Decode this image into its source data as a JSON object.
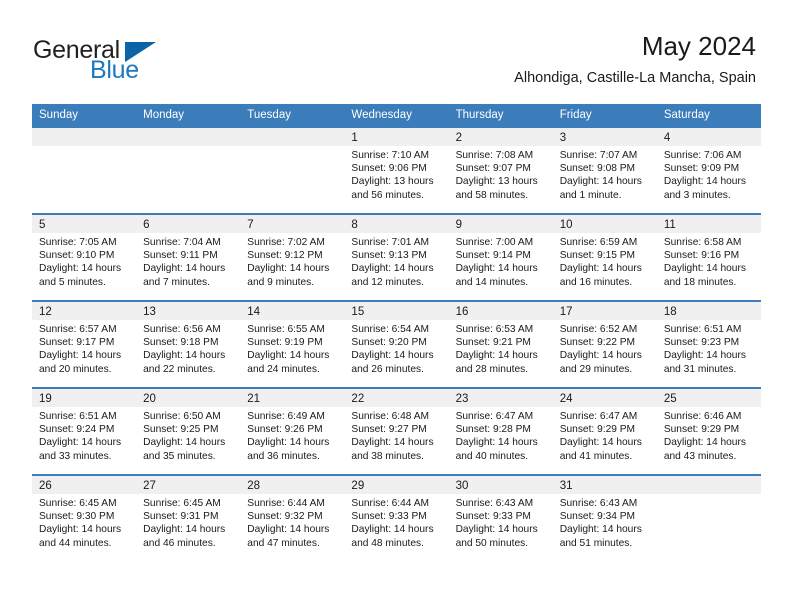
{
  "brand": {
    "name_part1": "General",
    "name_part2": "Blue",
    "accent_color": "#0a64a8",
    "blue_text_color": "#1c79c0"
  },
  "header": {
    "title": "May 2024",
    "subtitle": "Alhondiga, Castille-La Mancha, Spain",
    "weekday_header_bg": "#3b7cba",
    "day_band_bg": "#f0f0f0"
  },
  "weekdays": [
    "Sunday",
    "Monday",
    "Tuesday",
    "Wednesday",
    "Thursday",
    "Friday",
    "Saturday"
  ],
  "labels": {
    "sunrise": "Sunrise:",
    "sunset": "Sunset:",
    "daylight": "Daylight:"
  },
  "weeks": [
    [
      {
        "day": "",
        "sunrise": "",
        "sunset": "",
        "daylight_line1": "",
        "daylight_line2": ""
      },
      {
        "day": "",
        "sunrise": "",
        "sunset": "",
        "daylight_line1": "",
        "daylight_line2": ""
      },
      {
        "day": "",
        "sunrise": "",
        "sunset": "",
        "daylight_line1": "",
        "daylight_line2": ""
      },
      {
        "day": "1",
        "sunrise": "Sunrise: 7:10 AM",
        "sunset": "Sunset: 9:06 PM",
        "daylight_line1": "Daylight: 13 hours",
        "daylight_line2": "and 56 minutes."
      },
      {
        "day": "2",
        "sunrise": "Sunrise: 7:08 AM",
        "sunset": "Sunset: 9:07 PM",
        "daylight_line1": "Daylight: 13 hours",
        "daylight_line2": "and 58 minutes."
      },
      {
        "day": "3",
        "sunrise": "Sunrise: 7:07 AM",
        "sunset": "Sunset: 9:08 PM",
        "daylight_line1": "Daylight: 14 hours",
        "daylight_line2": "and 1 minute."
      },
      {
        "day": "4",
        "sunrise": "Sunrise: 7:06 AM",
        "sunset": "Sunset: 9:09 PM",
        "daylight_line1": "Daylight: 14 hours",
        "daylight_line2": "and 3 minutes."
      }
    ],
    [
      {
        "day": "5",
        "sunrise": "Sunrise: 7:05 AM",
        "sunset": "Sunset: 9:10 PM",
        "daylight_line1": "Daylight: 14 hours",
        "daylight_line2": "and 5 minutes."
      },
      {
        "day": "6",
        "sunrise": "Sunrise: 7:04 AM",
        "sunset": "Sunset: 9:11 PM",
        "daylight_line1": "Daylight: 14 hours",
        "daylight_line2": "and 7 minutes."
      },
      {
        "day": "7",
        "sunrise": "Sunrise: 7:02 AM",
        "sunset": "Sunset: 9:12 PM",
        "daylight_line1": "Daylight: 14 hours",
        "daylight_line2": "and 9 minutes."
      },
      {
        "day": "8",
        "sunrise": "Sunrise: 7:01 AM",
        "sunset": "Sunset: 9:13 PM",
        "daylight_line1": "Daylight: 14 hours",
        "daylight_line2": "and 12 minutes."
      },
      {
        "day": "9",
        "sunrise": "Sunrise: 7:00 AM",
        "sunset": "Sunset: 9:14 PM",
        "daylight_line1": "Daylight: 14 hours",
        "daylight_line2": "and 14 minutes."
      },
      {
        "day": "10",
        "sunrise": "Sunrise: 6:59 AM",
        "sunset": "Sunset: 9:15 PM",
        "daylight_line1": "Daylight: 14 hours",
        "daylight_line2": "and 16 minutes."
      },
      {
        "day": "11",
        "sunrise": "Sunrise: 6:58 AM",
        "sunset": "Sunset: 9:16 PM",
        "daylight_line1": "Daylight: 14 hours",
        "daylight_line2": "and 18 minutes."
      }
    ],
    [
      {
        "day": "12",
        "sunrise": "Sunrise: 6:57 AM",
        "sunset": "Sunset: 9:17 PM",
        "daylight_line1": "Daylight: 14 hours",
        "daylight_line2": "and 20 minutes."
      },
      {
        "day": "13",
        "sunrise": "Sunrise: 6:56 AM",
        "sunset": "Sunset: 9:18 PM",
        "daylight_line1": "Daylight: 14 hours",
        "daylight_line2": "and 22 minutes."
      },
      {
        "day": "14",
        "sunrise": "Sunrise: 6:55 AM",
        "sunset": "Sunset: 9:19 PM",
        "daylight_line1": "Daylight: 14 hours",
        "daylight_line2": "and 24 minutes."
      },
      {
        "day": "15",
        "sunrise": "Sunrise: 6:54 AM",
        "sunset": "Sunset: 9:20 PM",
        "daylight_line1": "Daylight: 14 hours",
        "daylight_line2": "and 26 minutes."
      },
      {
        "day": "16",
        "sunrise": "Sunrise: 6:53 AM",
        "sunset": "Sunset: 9:21 PM",
        "daylight_line1": "Daylight: 14 hours",
        "daylight_line2": "and 28 minutes."
      },
      {
        "day": "17",
        "sunrise": "Sunrise: 6:52 AM",
        "sunset": "Sunset: 9:22 PM",
        "daylight_line1": "Daylight: 14 hours",
        "daylight_line2": "and 29 minutes."
      },
      {
        "day": "18",
        "sunrise": "Sunrise: 6:51 AM",
        "sunset": "Sunset: 9:23 PM",
        "daylight_line1": "Daylight: 14 hours",
        "daylight_line2": "and 31 minutes."
      }
    ],
    [
      {
        "day": "19",
        "sunrise": "Sunrise: 6:51 AM",
        "sunset": "Sunset: 9:24 PM",
        "daylight_line1": "Daylight: 14 hours",
        "daylight_line2": "and 33 minutes."
      },
      {
        "day": "20",
        "sunrise": "Sunrise: 6:50 AM",
        "sunset": "Sunset: 9:25 PM",
        "daylight_line1": "Daylight: 14 hours",
        "daylight_line2": "and 35 minutes."
      },
      {
        "day": "21",
        "sunrise": "Sunrise: 6:49 AM",
        "sunset": "Sunset: 9:26 PM",
        "daylight_line1": "Daylight: 14 hours",
        "daylight_line2": "and 36 minutes."
      },
      {
        "day": "22",
        "sunrise": "Sunrise: 6:48 AM",
        "sunset": "Sunset: 9:27 PM",
        "daylight_line1": "Daylight: 14 hours",
        "daylight_line2": "and 38 minutes."
      },
      {
        "day": "23",
        "sunrise": "Sunrise: 6:47 AM",
        "sunset": "Sunset: 9:28 PM",
        "daylight_line1": "Daylight: 14 hours",
        "daylight_line2": "and 40 minutes."
      },
      {
        "day": "24",
        "sunrise": "Sunrise: 6:47 AM",
        "sunset": "Sunset: 9:29 PM",
        "daylight_line1": "Daylight: 14 hours",
        "daylight_line2": "and 41 minutes."
      },
      {
        "day": "25",
        "sunrise": "Sunrise: 6:46 AM",
        "sunset": "Sunset: 9:29 PM",
        "daylight_line1": "Daylight: 14 hours",
        "daylight_line2": "and 43 minutes."
      }
    ],
    [
      {
        "day": "26",
        "sunrise": "Sunrise: 6:45 AM",
        "sunset": "Sunset: 9:30 PM",
        "daylight_line1": "Daylight: 14 hours",
        "daylight_line2": "and 44 minutes."
      },
      {
        "day": "27",
        "sunrise": "Sunrise: 6:45 AM",
        "sunset": "Sunset: 9:31 PM",
        "daylight_line1": "Daylight: 14 hours",
        "daylight_line2": "and 46 minutes."
      },
      {
        "day": "28",
        "sunrise": "Sunrise: 6:44 AM",
        "sunset": "Sunset: 9:32 PM",
        "daylight_line1": "Daylight: 14 hours",
        "daylight_line2": "and 47 minutes."
      },
      {
        "day": "29",
        "sunrise": "Sunrise: 6:44 AM",
        "sunset": "Sunset: 9:33 PM",
        "daylight_line1": "Daylight: 14 hours",
        "daylight_line2": "and 48 minutes."
      },
      {
        "day": "30",
        "sunrise": "Sunrise: 6:43 AM",
        "sunset": "Sunset: 9:33 PM",
        "daylight_line1": "Daylight: 14 hours",
        "daylight_line2": "and 50 minutes."
      },
      {
        "day": "31",
        "sunrise": "Sunrise: 6:43 AM",
        "sunset": "Sunset: 9:34 PM",
        "daylight_line1": "Daylight: 14 hours",
        "daylight_line2": "and 51 minutes."
      },
      {
        "day": "",
        "sunrise": "",
        "sunset": "",
        "daylight_line1": "",
        "daylight_line2": ""
      }
    ]
  ]
}
